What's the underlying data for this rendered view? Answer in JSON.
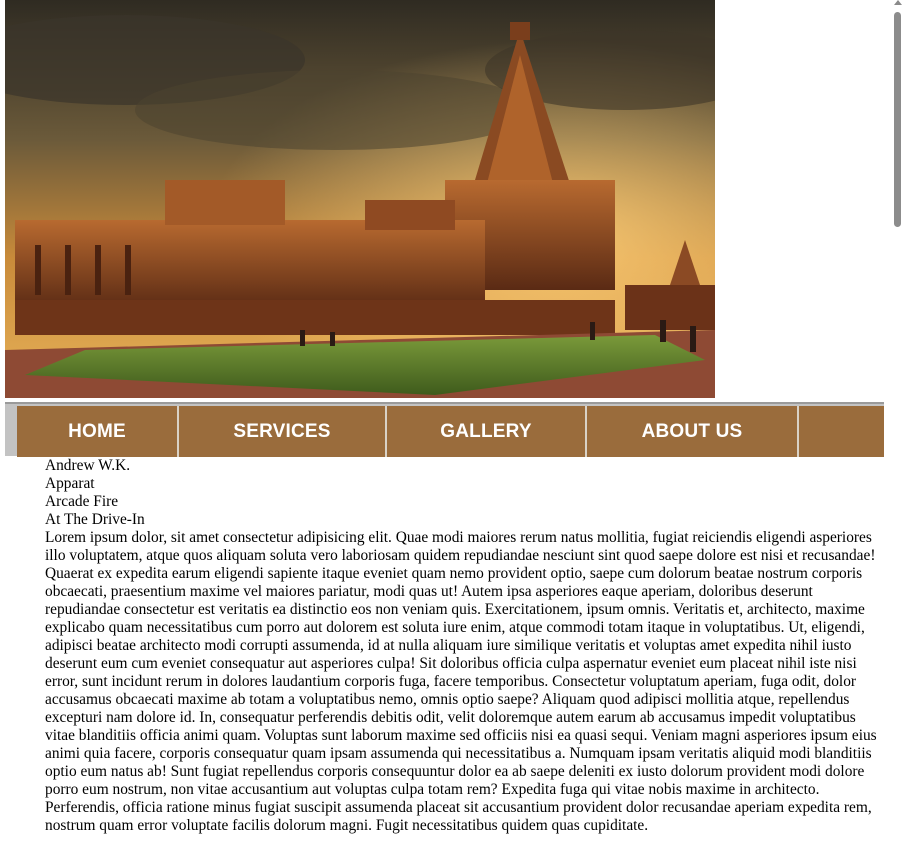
{
  "hero": {
    "image": "temple-sunset-photo",
    "alt": "Temple at sunset"
  },
  "nav": {
    "items": [
      {
        "label": "HOME"
      },
      {
        "label": "SERVICES"
      },
      {
        "label": "GALLERY"
      },
      {
        "label": "ABOUT US"
      },
      {
        "label": ""
      }
    ],
    "colors": {
      "item_bg": "#9a6c3c",
      "bar_bg": "#c3c3c3",
      "text": "#ffffff"
    }
  },
  "content": {
    "artists": [
      "Andrew W.K.",
      "Apparat",
      "Arcade Fire",
      "At The Drive-In"
    ],
    "paragraph": "Lorem ipsum dolor, sit amet consectetur adipisicing elit. Quae modi maiores rerum natus mollitia, fugiat reiciendis eligendi asperiores illo voluptatem, atque quos aliquam soluta vero laboriosam quidem repudiandae nesciunt sint quod saepe dolore est nisi et recusandae! Quaerat ex expedita earum eligendi sapiente itaque eveniet quam nemo provident optio, saepe cum dolorum beatae nostrum corporis obcaecati, praesentium maxime vel maiores pariatur, modi quas ut! Autem ipsa asperiores eaque aperiam, doloribus deserunt repudiandae consectetur est veritatis ea distinctio eos non veniam quis. Exercitationem, ipsum omnis. Veritatis et, architecto, maxime explicabo quam necessitatibus cum porro aut dolorem est soluta iure enim, atque commodi totam itaque in voluptatibus. Ut, eligendi, adipisci beatae architecto modi corrupti assumenda, id at nulla aliquam iure similique veritatis et voluptas amet expedita nihil iusto deserunt eum cum eveniet consequatur aut asperiores culpa! Sit doloribus officia culpa aspernatur eveniet eum placeat nihil iste nisi error, sunt incidunt rerum in dolores laudantium corporis fuga, facere temporibus. Consectetur voluptatum aperiam, fuga odit, dolor accusamus obcaecati maxime ab totam a voluptatibus nemo, omnis optio saepe? Aliquam quod adipisci mollitia atque, repellendus excepturi nam dolore id. In, consequatur perferendis debitis odit, velit doloremque autem earum ab accusamus impedit voluptatibus vitae blanditiis officia animi quam. Voluptas sunt laborum maxime sed officiis nisi ea quasi sequi. Veniam magni asperiores ipsum eius animi quia facere, corporis consequatur quam ipsam assumenda qui necessitatibus a. Numquam ipsam veritatis aliquid modi blanditiis optio eum natus ab! Sunt fugiat repellendus corporis consequuntur dolor ea ab saepe deleniti ex iusto dolorum provident modi dolore porro eum nostrum, non vitae accusantium aut voluptas culpa totam rem? Expedita fuga qui vitae nobis maxime in architecto. Perferendis, officia ratione minus fugiat suscipit assumenda placeat sit accusantium provident dolor recusandae aperiam expedita rem, nostrum quam error voluptate facilis dolorum magni. Fugit necessitatibus quidem quas cupiditate."
  }
}
